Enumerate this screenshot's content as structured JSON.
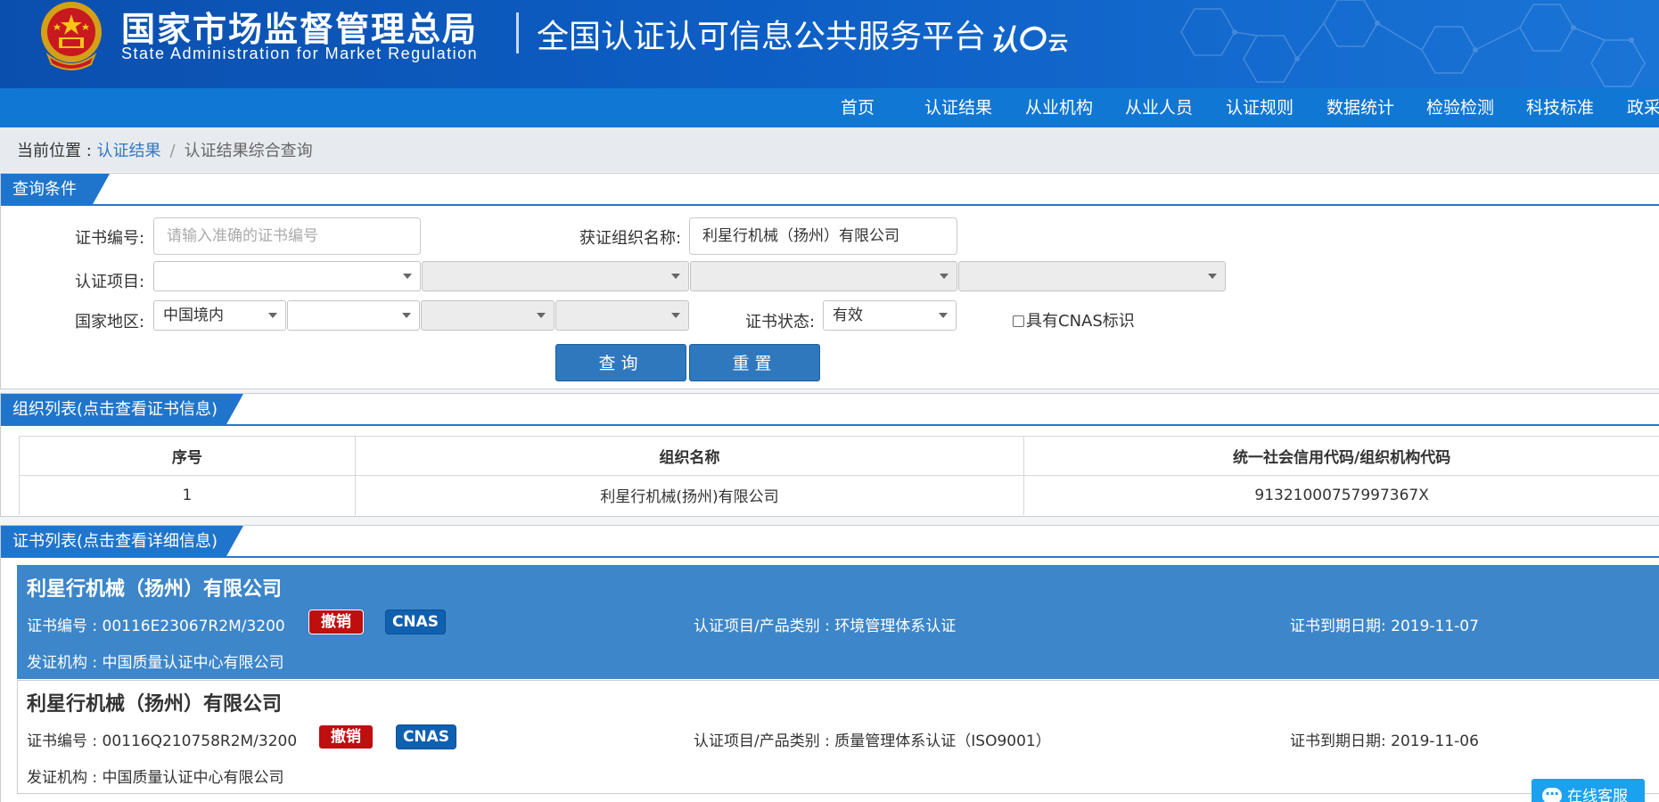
{
  "header": {
    "gov_name": "国家市场监督管理总局",
    "gov_name_en": "State Administration  for  Market Regulation",
    "platform_name": "全国认证认可信息公共服务平台",
    "platform_logo_text": "认",
    "platform_logo_sub": "云",
    "colors": {
      "header_bg": "#0d5ec4",
      "nav_bg": "#1177d4",
      "accent": "#1f75cc"
    }
  },
  "nav": {
    "items": [
      "首页",
      "认证结果",
      "从业机构",
      "从业人员",
      "认证规则",
      "数据统计",
      "检验检测",
      "科技标准",
      "政采"
    ]
  },
  "breadcrumb": {
    "prefix": "当前位置 : ",
    "link": "认证结果",
    "separator": "/",
    "current": "认证结果综合查询"
  },
  "query": {
    "title": "查询条件",
    "cert_no_label": "证书编号:",
    "cert_no_placeholder": "请输入准确的证书编号",
    "org_name_label": "获证组织名称:",
    "org_name_value": "利星行机械（扬州）有限公司",
    "project_label": "认证项目:",
    "project_selects": [
      "",
      "",
      "",
      ""
    ],
    "region_label": "国家地区:",
    "region_selects": [
      "中国境内",
      "",
      "",
      ""
    ],
    "status_label": "证书状态:",
    "status_value": "有效",
    "cnas_checkbox_label": "具有CNAS标识",
    "cnas_checked": false,
    "query_button": "查询",
    "reset_button": "重置"
  },
  "org_list": {
    "title": "组织列表(点击查看证书信息)",
    "columns": [
      "序号",
      "组织名称",
      "统一社会信用代码/组织机构代码"
    ],
    "rows": [
      [
        "1",
        "利星行机械(扬州)有限公司",
        "91321000757997367X"
      ]
    ]
  },
  "cert_list": {
    "title": "证书列表(点击查看详细信息)",
    "items": [
      {
        "org": "利星行机械（扬州）有限公司",
        "cert_no": "证书编号 : 00116E23067R2M/3200",
        "badge_status": "撤销",
        "badge_cnas": "CNAS",
        "project": "认证项目/产品类别 : 环境管理体系认证",
        "expiry": "证书到期日期: 2019-11-07",
        "issuer": "发证机构 : 中国质量认证中心有限公司"
      },
      {
        "org": "利星行机械（扬州）有限公司",
        "cert_no": "证书编号 : 00116Q210758R2M/3200",
        "badge_status": "撤销",
        "badge_cnas": "CNAS",
        "project": "认证项目/产品类别 : 质量管理体系认证（ISO9001）",
        "expiry": "证书到期日期: 2019-11-06",
        "issuer": "发证机构 : 中国质量认证中心有限公司"
      }
    ]
  },
  "online_service": {
    "label": "在线客服",
    "icon": "chat-icon"
  }
}
